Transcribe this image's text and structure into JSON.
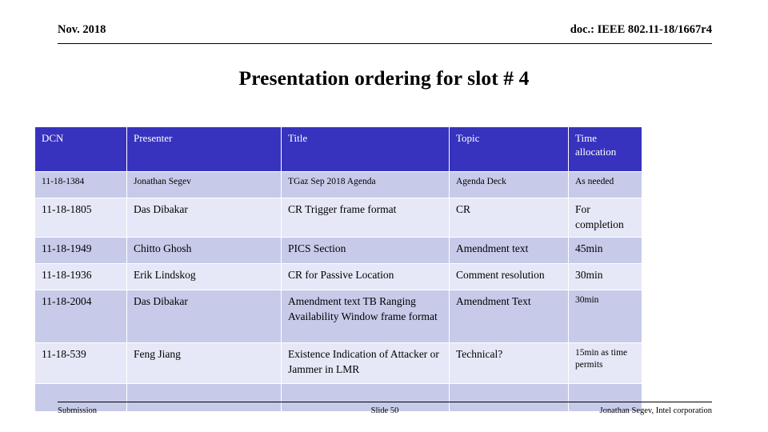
{
  "header": {
    "date": "Nov. 2018",
    "doc": "doc.: IEEE 802.11-18/1667r4"
  },
  "title": "Presentation ordering for slot # 4",
  "table": {
    "columns": [
      "DCN",
      "Presenter",
      "Title",
      "Topic",
      "Time allocation"
    ],
    "header_bg": "#3733BE",
    "header_fg": "#FFFFFF",
    "row_shade_dark": "#C7CBE9",
    "row_shade_light": "#E6E8F7",
    "rows": [
      {
        "dcn": "11-18-1384",
        "presenter": "Jonathan Segev",
        "title": "TGaz Sep 2018 Agenda",
        "topic": "Agenda Deck",
        "time": "As needed"
      },
      {
        "dcn": "11-18-1805",
        "presenter": "Das Dibakar",
        "title": "CR Trigger frame format",
        "topic": "CR",
        "time": "For completion"
      },
      {
        "dcn": "11-18-1949",
        "presenter": "Chitto Ghosh",
        "title": "PICS Section",
        "topic": "Amendment text",
        "time": "45min"
      },
      {
        "dcn": "11-18-1936",
        "presenter": "Erik Lindskog",
        "title": "CR for Passive Location",
        "topic": "Comment resolution",
        "time": "30min"
      },
      {
        "dcn": "11-18-2004",
        "presenter": "Das Dibakar",
        "title": "Amendment text TB Ranging Availability Window frame format",
        "topic": "Amendment Text",
        "time": "30min"
      },
      {
        "dcn": "11-18-539",
        "presenter": "Feng Jiang",
        "title": "Existence Indication of Attacker or Jammer in LMR",
        "topic": "Technical?",
        "time": "15min as time permits"
      },
      {
        "dcn": "",
        "presenter": "",
        "title": "",
        "topic": "",
        "time": ""
      }
    ]
  },
  "footer": {
    "left": "Submission",
    "center": "Slide 50",
    "right": "Jonathan Segev, Intel corporation"
  }
}
